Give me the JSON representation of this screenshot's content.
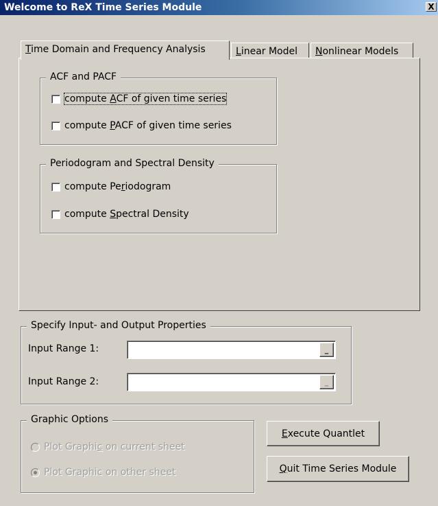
{
  "window": {
    "title": "Welcome to ReX Time Series Module",
    "close_glyph": "X"
  },
  "tabs": [
    {
      "label_pre": "",
      "label_ul": "T",
      "label_post": "ime Domain and Frequency Analysis",
      "active": true
    },
    {
      "label_pre": "",
      "label_ul": "L",
      "label_post": "inear Model",
      "active": false
    },
    {
      "label_pre": "",
      "label_ul": "N",
      "label_post": "onlinear Models",
      "active": false
    }
  ],
  "acf_group": {
    "legend": "ACF and PACF",
    "items": [
      {
        "pre": "compute ",
        "ul": "A",
        "post": "CF of given time series",
        "checked": false
      },
      {
        "pre": "compute ",
        "ul": "P",
        "post": "ACF of given time series",
        "checked": false
      }
    ]
  },
  "periodogram_group": {
    "legend": "Periodogram and Spectral Density",
    "items": [
      {
        "pre": "compute Pe",
        "ul": "r",
        "post": "iodogram",
        "checked": false
      },
      {
        "pre": "compute ",
        "ul": "S",
        "post": "pectral Density",
        "checked": false
      }
    ]
  },
  "io_group": {
    "legend": "Specify Input- and Output Properties",
    "input1_label": "Input Range 1:",
    "input1_value": "",
    "input2_label": "Input Range 2:",
    "input2_value": "",
    "ref_glyph": "_"
  },
  "graphic_group": {
    "legend": "Graphic Options",
    "options": [
      {
        "pre": "Plot Graphi",
        "ul": "c",
        "post": " on current sheet",
        "selected": false
      },
      {
        "pre": "Plot Graphic on other sheet",
        "ul": "",
        "post": "",
        "selected": true
      }
    ]
  },
  "buttons": {
    "execute": {
      "pre": "",
      "ul": "E",
      "post": "xecute Quantlet"
    },
    "quit": {
      "pre": "",
      "ul": "Q",
      "post": "uit Time Series Module"
    }
  },
  "colors": {
    "dialog_bg": "#d4d0c8",
    "title_start": "#0a246a",
    "title_end": "#a6caf0",
    "disabled_text": "#a0a0a0"
  }
}
